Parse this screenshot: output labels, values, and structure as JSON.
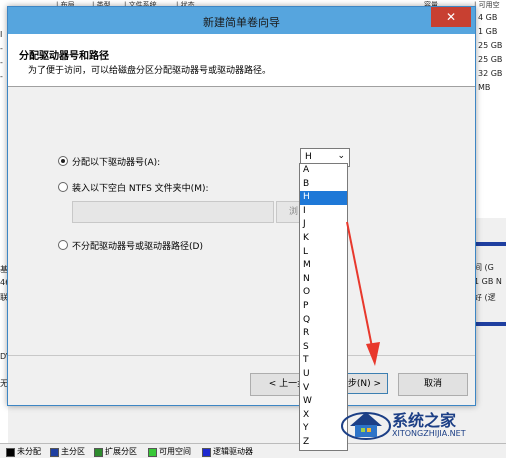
{
  "background": {
    "top_columns": [
      "| 布局",
      "| 类型",
      "| 文件系统",
      "| 状态",
      "容量",
      "| 可用空"
    ],
    "right_values": [
      "4 GB",
      "1 GB",
      "25 GB",
      "25 GB",
      "32 GB",
      "MB"
    ],
    "left_values": [
      "I",
      "-",
      "-",
      "-"
    ],
    "left_disk_labels": [
      "基",
      "46",
      "联"
    ],
    "left_dvd_label": "DV",
    "left_no_media": "无",
    "volume_labels": [
      "间 (G",
      "1 GB N",
      "好 (逻"
    ],
    "legend": [
      {
        "label": "未分配",
        "color": "#000000"
      },
      {
        "label": "主分区",
        "color": "#1f3fa0"
      },
      {
        "label": "扩展分区",
        "color": "#2e8b2e"
      },
      {
        "label": "可用空间",
        "color": "#38c838"
      },
      {
        "label": "逻辑驱动器",
        "color": "#1e2ad0"
      }
    ]
  },
  "dialog": {
    "title": "新建简单卷向导",
    "close_glyph": "✕",
    "header_title": "分配驱动器号和路径",
    "header_subtitle": "为了便于访问，可以给磁盘分区分配驱动器号或驱动器路径。",
    "option_assign_letter": "分配以下驱动器号(A):",
    "option_mount_folder": "装入以下空白 NTFS 文件夹中(M):",
    "option_no_assign": "不分配驱动器号或驱动器路径(D)",
    "selected_option": "assign_letter",
    "path_input_value": "",
    "browse_label": "浏",
    "drive_letter_value": "H",
    "back_button": "< 上一步(B)",
    "next_button": "步(N) >",
    "cancel_button": "取消"
  },
  "dropdown": {
    "options": [
      "A",
      "B",
      "H",
      "I",
      "J",
      "K",
      "L",
      "M",
      "N",
      "O",
      "P",
      "Q",
      "R",
      "S",
      "T",
      "U",
      "V",
      "W",
      "X",
      "Y",
      "Z"
    ],
    "selected": "H"
  },
  "watermark": {
    "name": "系统之家",
    "url": "XITONGZHIJIA.NET"
  },
  "colors": {
    "titlebar": "#56a5de",
    "close": "#c84031",
    "selection": "#1e78d7",
    "arrow": "#e8382c",
    "watermark": "#1c3f86"
  }
}
